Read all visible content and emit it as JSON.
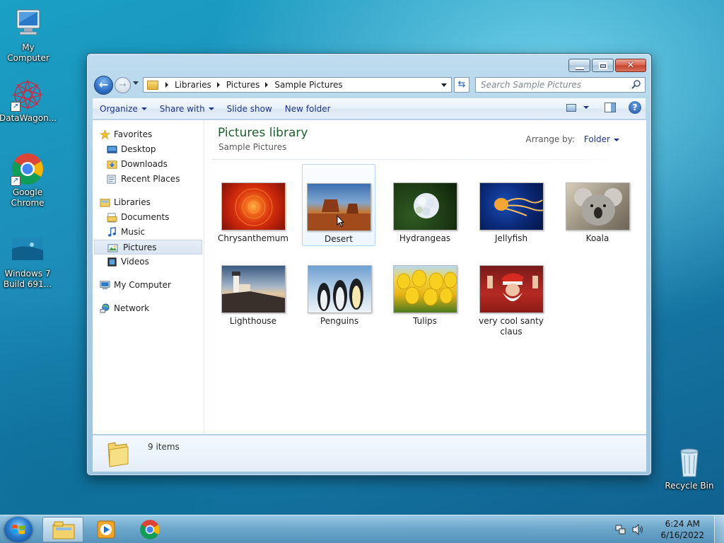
{
  "desktop": {
    "icons": [
      {
        "label": "My Computer"
      },
      {
        "label": "DataWagon..."
      },
      {
        "label": "Google Chrome"
      },
      {
        "label": "Windows 7 Build 691..."
      },
      {
        "label": "Recycle Bin"
      }
    ]
  },
  "window": {
    "breadcrumb": [
      "Libraries",
      "Pictures",
      "Sample Pictures"
    ],
    "search_placeholder": "Search Sample Pictures",
    "toolbar": {
      "organize": "Organize",
      "share_with": "Share with",
      "slide_show": "Slide show",
      "new_folder": "New folder"
    },
    "nav": {
      "favorites": "Favorites",
      "desktop": "Desktop",
      "downloads": "Downloads",
      "recent_places": "Recent Places",
      "libraries": "Libraries",
      "documents": "Documents",
      "music": "Music",
      "pictures": "Pictures",
      "videos": "Videos",
      "my_computer": "My Computer",
      "network": "Network"
    },
    "library_title": "Pictures library",
    "library_subtitle": "Sample Pictures",
    "arrange_label": "Arrange by:",
    "arrange_value": "Folder",
    "files": [
      {
        "name": "Chrysanthemum"
      },
      {
        "name": "Desert"
      },
      {
        "name": "Hydrangeas"
      },
      {
        "name": "Jellyfish"
      },
      {
        "name": "Koala"
      },
      {
        "name": "Lighthouse"
      },
      {
        "name": "Penguins"
      },
      {
        "name": "Tulips"
      },
      {
        "name": "very cool santy claus"
      }
    ],
    "status_count": "9 items"
  },
  "taskbar": {
    "time": "6:24 AM",
    "date": "6/16/2022"
  }
}
